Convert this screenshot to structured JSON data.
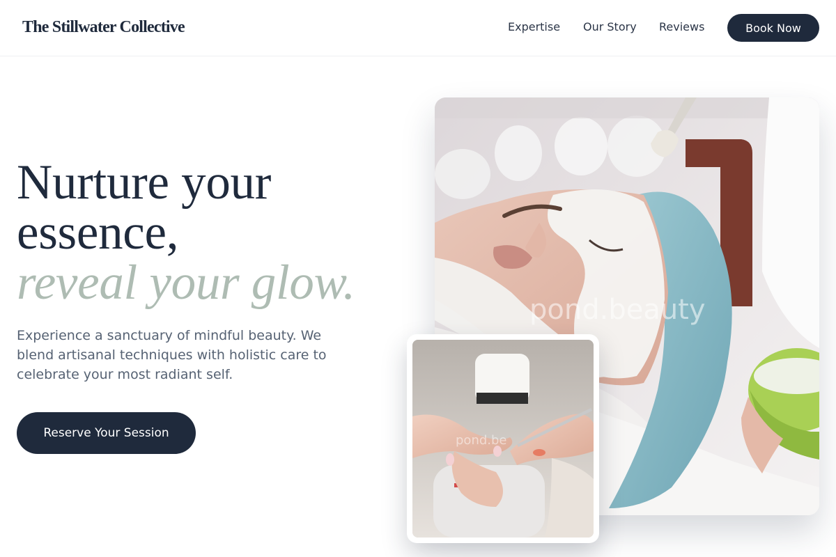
{
  "brand": {
    "name": "The Stillwater Collective"
  },
  "nav": {
    "items": [
      {
        "label": "Expertise"
      },
      {
        "label": "Our Story"
      },
      {
        "label": "Reviews"
      }
    ],
    "book_label": "Book Now"
  },
  "hero": {
    "headline_line1": "Nurture your",
    "headline_line2": "essence,",
    "headline_accent": "reveal your glow.",
    "subtext": "Experience a sanctuary of mindful beauty. We blend artisanal techniques with holistic care to celebrate your most radiant self.",
    "cta_label": "Reserve Your Session"
  },
  "images": {
    "main": {
      "subject": "facial treatment photo",
      "watermark": "pond.beauty"
    },
    "inset": {
      "subject": "manicure photo",
      "watermark": "pond.be"
    }
  },
  "colors": {
    "primary": "#1f2a3c",
    "accent": "#aebcb3",
    "body_text": "#566273"
  }
}
